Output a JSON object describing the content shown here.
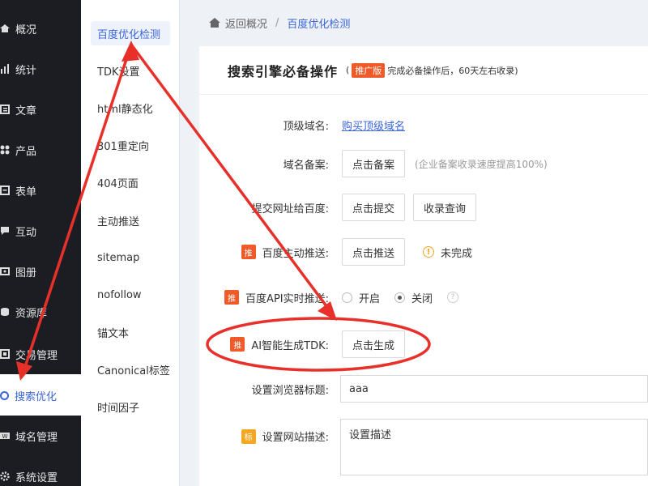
{
  "sidebar": {
    "items": [
      {
        "label": "概况",
        "icon": "home-icon"
      },
      {
        "label": "统计",
        "icon": "chart-icon"
      },
      {
        "label": "文章",
        "icon": "article-icon"
      },
      {
        "label": "产品",
        "icon": "grid-icon"
      },
      {
        "label": "表单",
        "icon": "form-icon"
      },
      {
        "label": "互动",
        "icon": "chat-icon"
      },
      {
        "label": "图册",
        "icon": "image-icon"
      },
      {
        "label": "资源库",
        "icon": "database-icon"
      },
      {
        "label": "交易管理",
        "icon": "trade-icon"
      },
      {
        "label": "搜索优化",
        "icon": "target-icon"
      },
      {
        "label": "域名管理",
        "icon": "domain-icon"
      },
      {
        "label": "系统设置",
        "icon": "gear-icon"
      }
    ]
  },
  "submenu": {
    "items": [
      "百度优化检测",
      "TDK设置",
      "html静态化",
      "301重定向",
      "404页面",
      "主动推送",
      "sitemap",
      "nofollow",
      "锚文本",
      "Canonical标签",
      "时间因子"
    ]
  },
  "breadcrumb": {
    "home": "返回概况",
    "separator": "/",
    "current": "百度优化检测"
  },
  "card": {
    "title": "搜索引擎必备操作",
    "subtitle_open": "(",
    "badge": "推广版",
    "subtitle_text": "完成必备操作后，60天左右收录)",
    "rows": {
      "domain": {
        "label": "顶级域名:",
        "link": "购买顶级域名"
      },
      "icp": {
        "label": "域名备案:",
        "button": "点击备案",
        "hint": "(企业备案收录速度提高100%)"
      },
      "submit": {
        "label": "提交网址给百度:",
        "button": "点击提交",
        "button2": "收录查询"
      },
      "push": {
        "badge": "推",
        "label": "百度主动推送:",
        "button": "点击推送",
        "status": "未完成",
        "status_icon": "!"
      },
      "api": {
        "badge": "推",
        "label": "百度API实时推送:",
        "on": "开启",
        "off": "关闭",
        "help": "?"
      },
      "tdk": {
        "badge": "推",
        "label": "AI智能生成TDK:",
        "button": "点击生成"
      },
      "browser_title": {
        "label": "设置浏览器标题:",
        "value": "aaa"
      },
      "description": {
        "badge": "标",
        "label": "设置网站描述:",
        "value": "设置描述"
      }
    }
  },
  "colors": {
    "accent": "#3b66d9",
    "annotation": "#e8302a",
    "badge": "#f05a28",
    "sidebar": "#1b1d22"
  }
}
